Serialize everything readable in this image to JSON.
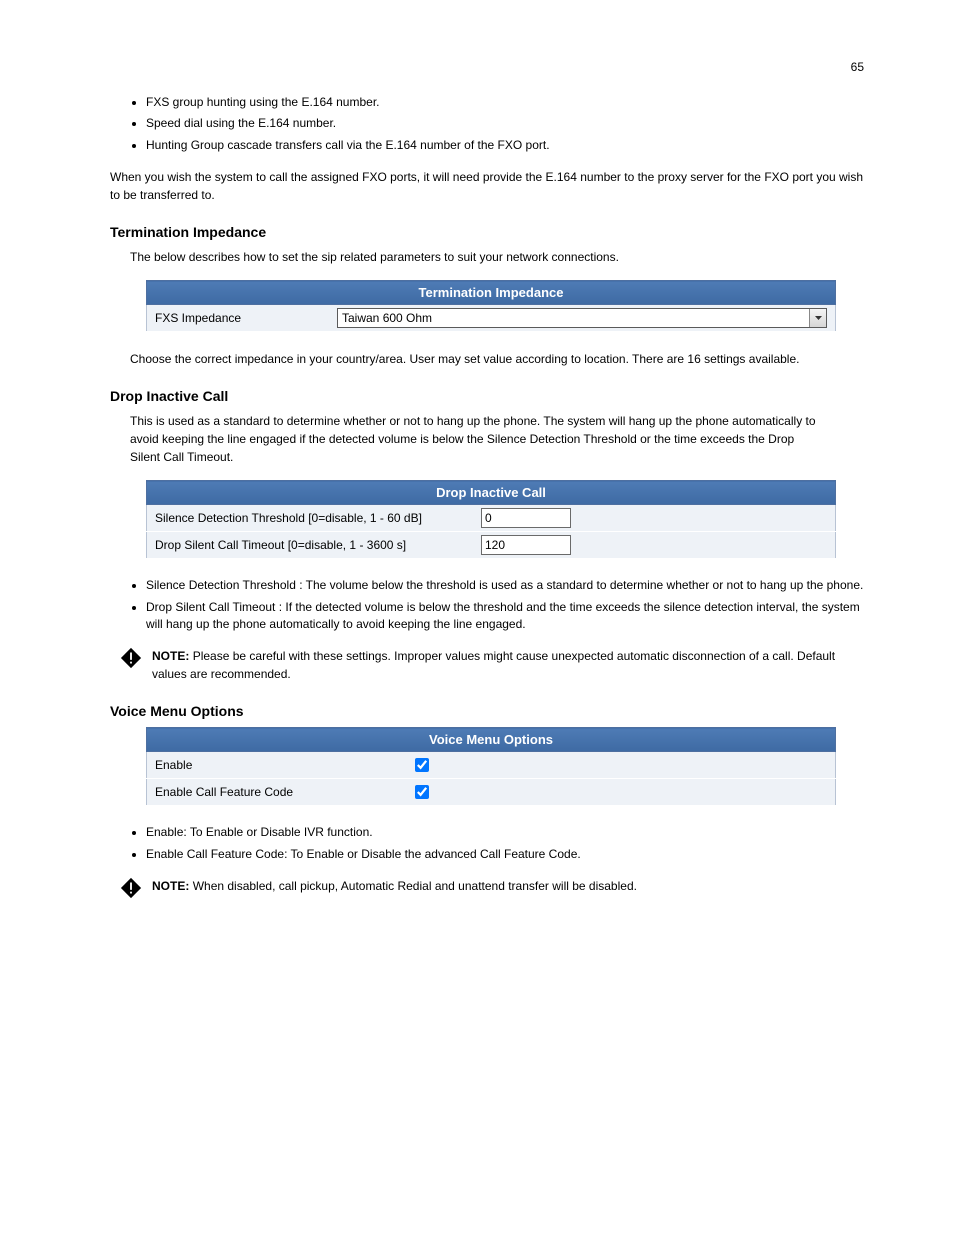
{
  "page_number": "65",
  "bullets_top": [
    "FXS group hunting using the E.164 number.",
    "Speed dial using the E.164 number.",
    "Hunting Group cascade transfers call via the E.164 number of the FXO port."
  ],
  "e164_desc": "When you wish the system to call the assigned FXO ports, it will need provide the E.164 number to the proxy server for the FXO port you wish to be transferred to.",
  "termination_title": "Termination Impedance",
  "termination_desc": "The below describes how to set the sip related parameters to suit your network connections.",
  "termination_table": {
    "header": "Termination Impedance",
    "label": "FXS Impedance",
    "value": "Taiwan  600 Ohm"
  },
  "termination_after": "Choose the correct impedance in your country/area. User may set value according to location. There are 16 settings available.",
  "drop_title": "Drop Inactive Call",
  "drop_desc": "This is used as a standard to determine whether or not to hang up the phone. The system will hang up the phone automatically to avoid keeping the line engaged if the detected volume is below the Silence Detection Threshold or the time exceeds the Drop Silent Call Timeout.",
  "drop_table": {
    "header": "Drop Inactive Call",
    "row1_label": "Silence Detection Threshold [0=disable, 1 - 60 dB]",
    "row1_value": "0",
    "row2_label": "Drop Silent Call Timeout [0=disable, 1 - 3600 s]",
    "row2_value": "120"
  },
  "drop_bullets": [
    "Silence Detection Threshold : The volume below the threshold is used as a standard to determine whether or not to hang up the phone.",
    "Drop Silent Call Timeout : If the detected volume is below the threshold and the time exceeds the silence detection interval, the system will hang up the phone automatically to avoid keeping the line engaged."
  ],
  "drop_note": "Please be careful with these settings.  Improper values might cause unexpected automatic disconnection of a call.  Default values are recommended.",
  "voice_title": "Voice Menu Options",
  "voice_table": {
    "header": "Voice Menu Options",
    "row1_label": "Enable",
    "row1_checked": true,
    "row2_label": "Enable Call Feature Code",
    "row2_checked": true
  },
  "voice_bullets": [
    "Enable: To Enable or Disable IVR function.",
    "Enable Call Feature Code: To Enable or Disable the advanced Call Feature Code."
  ],
  "voice_note": "When disabled, call pickup, Automatic Redial and unattend transfer will be disabled.",
  "note_label": "NOTE:"
}
